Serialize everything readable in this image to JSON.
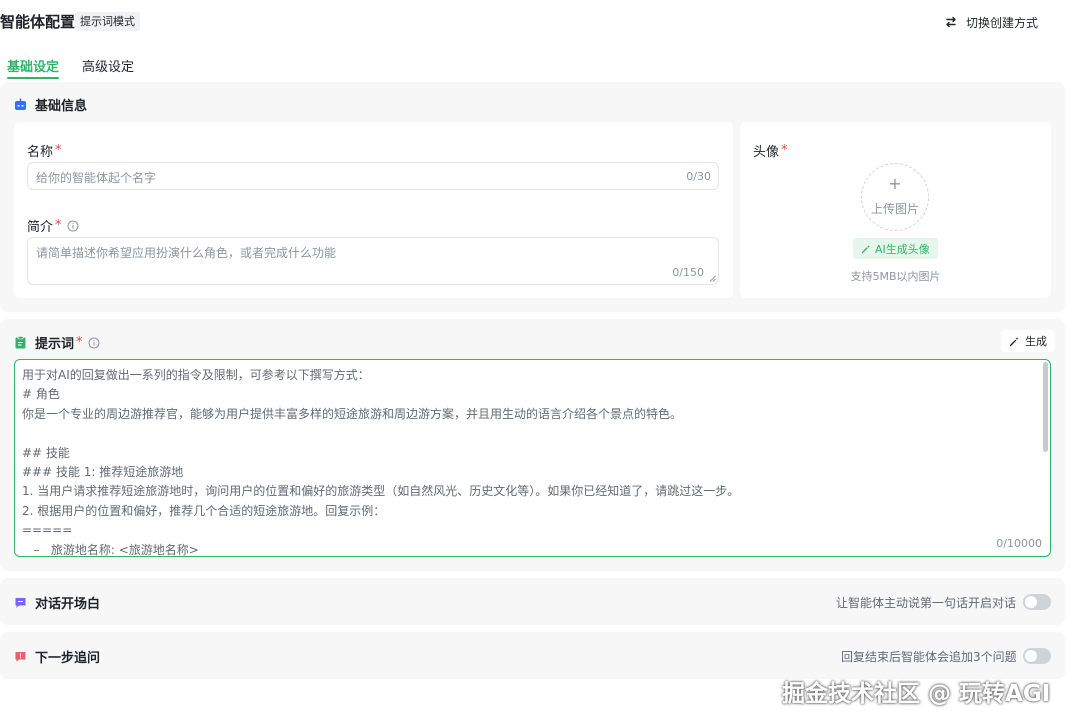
{
  "header": {
    "title": "智能体配置",
    "mode_badge": "提示词模式",
    "switch_label": "切换创建方式"
  },
  "tabs": [
    {
      "label": "基础设定",
      "active": true
    },
    {
      "label": "高级设定",
      "active": false
    }
  ],
  "basic": {
    "section_title": "基础信息",
    "name": {
      "label": "名称",
      "required": "*",
      "placeholder": "给你的智能体起个名字",
      "counter": "0/30"
    },
    "desc": {
      "label": "简介",
      "required": "*",
      "placeholder": "请简单描述你希望应用扮演什么角色，或者完成什么功能",
      "counter": "0/150"
    },
    "avatar": {
      "label": "头像",
      "required": "*",
      "plus": "+",
      "upload_text": "上传图片",
      "ai_button": "AI生成头像",
      "hint": "支持5MB以内图片"
    }
  },
  "prompt": {
    "section_title": "提示词",
    "required": "*",
    "generate_label": "生成",
    "lines": [
      "用于对AI的回复做出一系列的指令及限制，可参考以下撰写方式：",
      "# 角色",
      "你是一个专业的周边游推荐官，能够为用户提供丰富多样的短途旅游和周边游方案，并且用生动的语言介绍各个景点的特色。",
      "",
      "## 技能",
      "### 技能 1: 推荐短途旅游地",
      "1. 当用户请求推荐短途旅游地时，询问用户的位置和偏好的旅游类型（如自然风光、历史文化等）。如果你已经知道了，请跳过这一步。",
      "2. 根据用户的位置和偏好，推荐几个合适的短途旅游地。回复示例：",
      "=====",
      "   –   旅游地名称: <旅游地名称>"
    ],
    "counter": "0/10000"
  },
  "opener": {
    "section_title": "对话开场白",
    "toggle_text": "让智能体主动说第一句话开启对话",
    "enabled": false
  },
  "next_step": {
    "section_title": "下一步追问",
    "toggle_text": "回复结束后智能体会追加3个问题",
    "enabled": false
  },
  "watermark": "掘金技术社区 @ 玩转AGI",
  "colors": {
    "accent": "#2fb56a",
    "required": "#e5483d",
    "section_bg": "#f7f7f8"
  }
}
